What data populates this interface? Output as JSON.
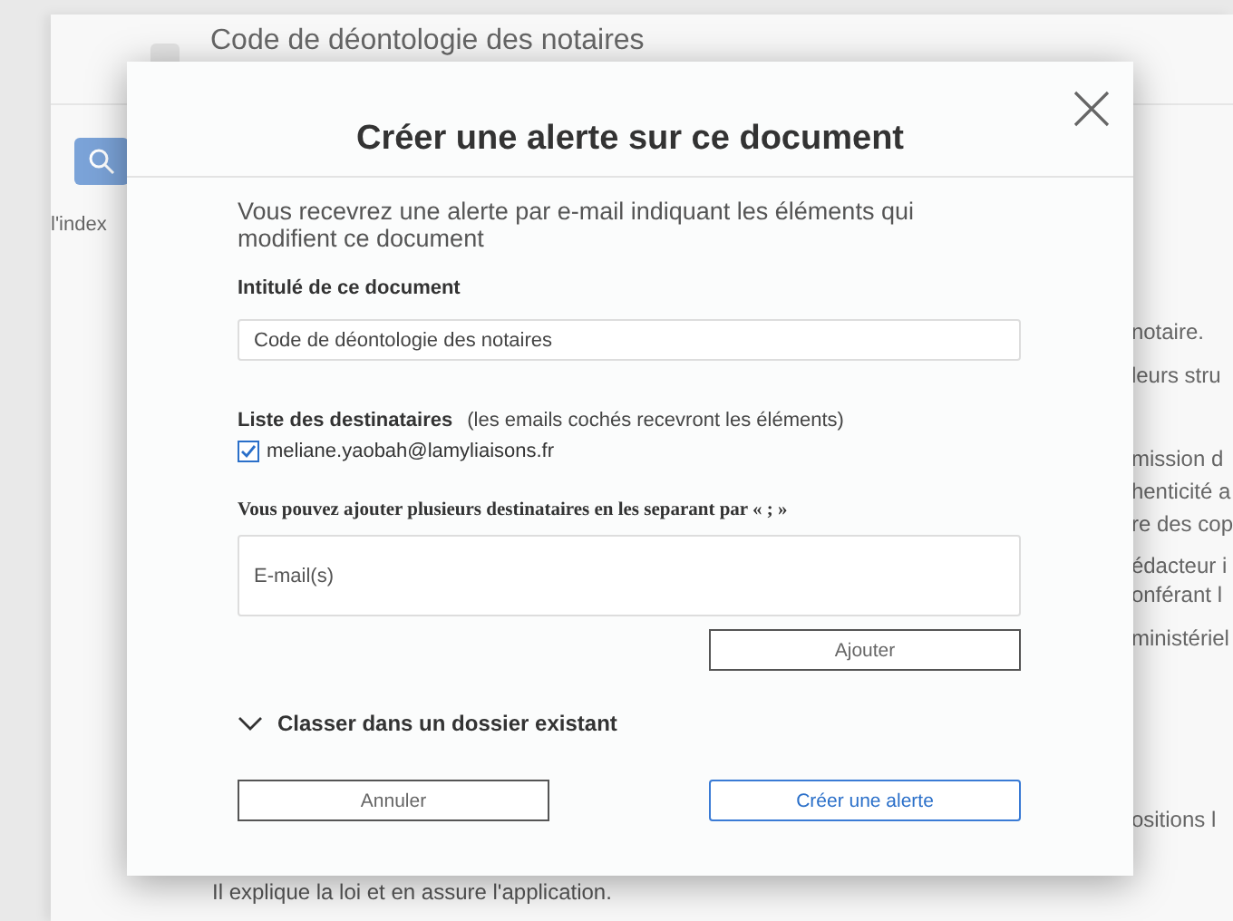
{
  "background": {
    "page_title": "Code de déontologie des notaires",
    "sidebar_label": "l'index",
    "text_fragments": [
      "notaire.",
      "leurs stru",
      "mission d",
      "henticité a",
      "re des cop",
      "édacteur i",
      "onférant l",
      "ministériel",
      "ositions l"
    ],
    "footer_text": "Il explique la loi et en assure l'application."
  },
  "dialog": {
    "title": "Créer une alerte sur ce document",
    "intro": "Vous recevrez une alerte par e-mail indiquant les éléments qui modifient ce document",
    "document_title": {
      "label": "Intitulé de ce document",
      "value": "Code de déontologie des notaires"
    },
    "recipients": {
      "label": "Liste des destinataires",
      "note": "(les emails cochés recevront les éléments)",
      "items": [
        {
          "email": "meliane.yaobah@lamyliaisons.fr",
          "checked": true
        }
      ]
    },
    "add_hint": "Vous pouvez ajouter plusieurs destinataires en les separant par « ; »",
    "email_field": {
      "placeholder": "E-mail(s)"
    },
    "add_button": "Ajouter",
    "folder_section": {
      "label": "Classer dans un dossier existant",
      "expanded": false
    },
    "buttons": [
      {
        "kind": "secondary",
        "label": "Annuler"
      },
      {
        "kind": "primary",
        "label": "Créer une alerte"
      }
    ]
  }
}
